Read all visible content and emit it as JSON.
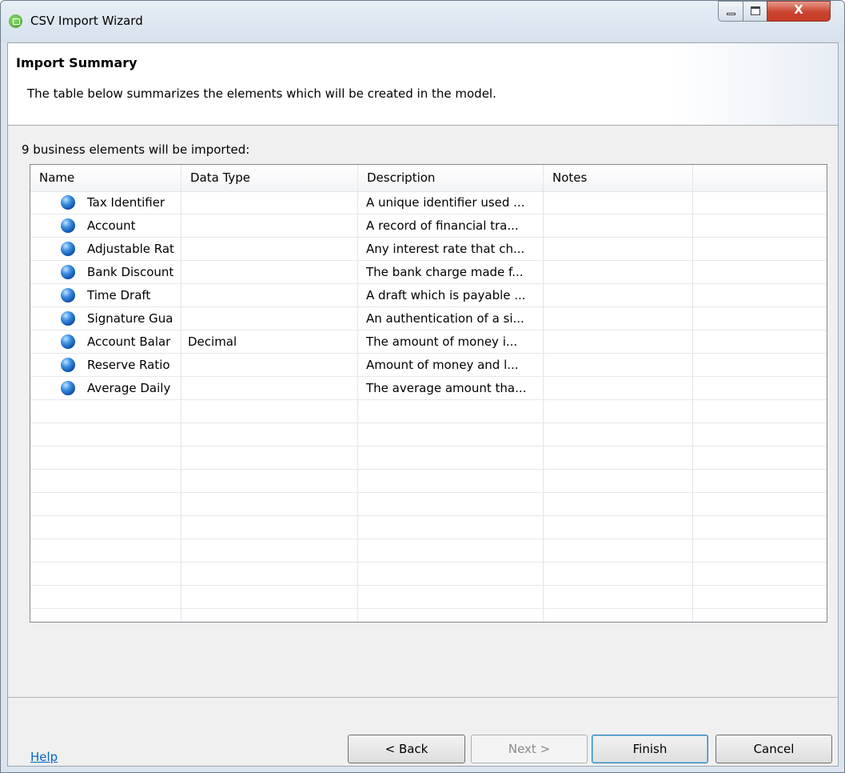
{
  "window": {
    "title": "CSV Import Wizard",
    "close_glyph": "X"
  },
  "header": {
    "title": "Import Summary",
    "description": "The table below summarizes the elements which will be created in the model."
  },
  "count_label": "9 business elements will be imported:",
  "table": {
    "columns": [
      "Name",
      "Data Type",
      "Description",
      "Notes",
      ""
    ],
    "rows": [
      {
        "name": "Tax Identifier",
        "data_type": "",
        "description": "A unique identifier used ...",
        "notes": ""
      },
      {
        "name": "Account",
        "data_type": "",
        "description": "A record of financial tra...",
        "notes": ""
      },
      {
        "name": "Adjustable Rat",
        "data_type": "",
        "description": "Any interest rate that ch...",
        "notes": ""
      },
      {
        "name": "Bank Discount",
        "data_type": "",
        "description": "The bank charge made f...",
        "notes": ""
      },
      {
        "name": "Time Draft",
        "data_type": "",
        "description": "A draft which is payable ...",
        "notes": ""
      },
      {
        "name": "Signature Gua",
        "data_type": "",
        "description": "An authentication of a si...",
        "notes": ""
      },
      {
        "name": "Account Balar",
        "data_type": "Decimal",
        "description": "The amount of money i...",
        "notes": ""
      },
      {
        "name": "Reserve Ratio",
        "data_type": "",
        "description": "Amount of money and l...",
        "notes": ""
      },
      {
        "name": "Average Daily",
        "data_type": "",
        "description": "The average amount tha...",
        "notes": ""
      }
    ],
    "row_icon": "business-element-ball-icon"
  },
  "footer": {
    "help": "Help",
    "back": "< Back",
    "next": "Next >",
    "finish": "Finish",
    "cancel": "Cancel"
  },
  "colors": {
    "link": "#0066cc",
    "close_button": "#c9432f",
    "element_icon": "#0d4da8"
  }
}
